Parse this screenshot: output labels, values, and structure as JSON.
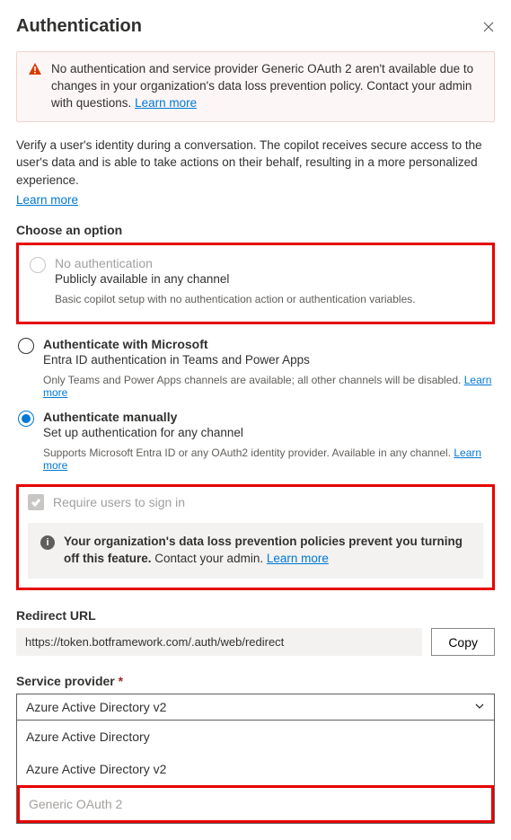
{
  "header": {
    "title": "Authentication"
  },
  "alert": {
    "text": "No authentication and service provider Generic OAuth 2 aren't available due to changes in your organization's data loss prevention policy. Contact your admin with questions. ",
    "learn_more": "Learn more"
  },
  "intro": {
    "text": "Verify a user's identity during a conversation. The copilot receives secure access to the user's data and is able to take actions on their behalf, resulting in a more personalized experience.",
    "learn_more": "Learn more"
  },
  "choose_label": "Choose an option",
  "options": {
    "none": {
      "title": "No authentication",
      "subtitle": "Publicly available in any channel",
      "note": "Basic copilot setup with no authentication action or authentication variables."
    },
    "ms": {
      "title": "Authenticate with Microsoft",
      "subtitle": "Entra ID authentication in Teams and Power Apps",
      "note": "Only Teams and Power Apps channels are available; all other channels will be disabled. ",
      "note_link": "Learn more"
    },
    "manual": {
      "title": "Authenticate manually",
      "subtitle": "Set up authentication for any channel",
      "note": "Supports Microsoft Entra ID or any OAuth2 identity provider. Available in any channel. ",
      "note_link": "Learn more"
    }
  },
  "require": {
    "label": "Require users to sign in",
    "info_bold": "Your organization's data loss prevention policies prevent you turning off this feature.",
    "info_rest": " Contact your admin. ",
    "info_link": "Learn more"
  },
  "redirect": {
    "label": "Redirect URL",
    "value": "https://token.botframework.com/.auth/web/redirect",
    "copy": "Copy"
  },
  "provider": {
    "label": "Service provider ",
    "required_mark": "*",
    "selected": "Azure Active Directory v2",
    "options": [
      "Azure Active Directory",
      "Azure Active Directory v2",
      "Generic OAuth 2"
    ]
  }
}
